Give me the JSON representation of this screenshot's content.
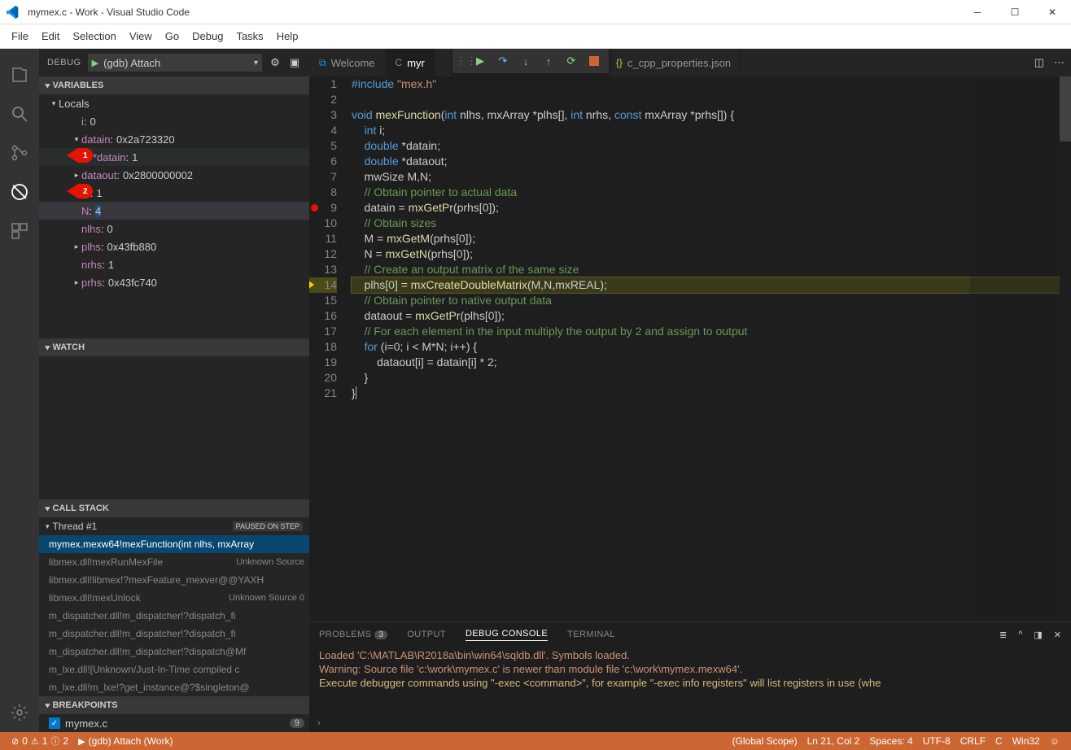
{
  "window": {
    "title": "mymex.c - Work - Visual Studio Code"
  },
  "menu": [
    "File",
    "Edit",
    "Selection",
    "View",
    "Go",
    "Debug",
    "Tasks",
    "Help"
  ],
  "debug": {
    "header_label": "DEBUG",
    "config": "(gdb) Attach"
  },
  "sections": {
    "variables": "VARIABLES",
    "watch": "WATCH",
    "callstack": "CALL STACK",
    "breakpoints": "BREAKPOINTS"
  },
  "locals_label": "Locals",
  "badges": {
    "b1": "1",
    "b2": "2"
  },
  "vars": [
    {
      "indent": 2,
      "name": "i",
      "val": "0",
      "type": "num"
    },
    {
      "indent": 2,
      "twisty": "▾",
      "name": "datain",
      "val": "0x2a723320",
      "type": "ptr"
    },
    {
      "indent": 3,
      "name": "*datain",
      "val": "1",
      "type": "num",
      "hl": true
    },
    {
      "indent": 2,
      "twisty": "▸",
      "name": "dataout",
      "val": "0x2800000002",
      "type": "ptr"
    },
    {
      "indent": 2,
      "name": "M",
      "val": "1",
      "type": "num"
    },
    {
      "indent": 2,
      "name": "N",
      "val": "4",
      "type": "num",
      "selval": true
    },
    {
      "indent": 2,
      "name": "nlhs",
      "val": "0",
      "type": "num"
    },
    {
      "indent": 2,
      "twisty": "▸",
      "name": "plhs",
      "val": "0x43fb880",
      "type": "ptr"
    },
    {
      "indent": 2,
      "name": "nrhs",
      "val": "1",
      "type": "num"
    },
    {
      "indent": 2,
      "twisty": "▸",
      "name": "prhs",
      "val": "0x43fc740",
      "type": "ptr"
    }
  ],
  "thread": {
    "label": "Thread #1",
    "status": "PAUSED ON STEP"
  },
  "callstack": [
    {
      "text": "mymex.mexw64!mexFunction(int nlhs, mxArray",
      "hl": true
    },
    {
      "text": "libmex.dll!mexRunMexFile",
      "right": "Unknown Source"
    },
    {
      "text": "libmex.dll!libmex!?mexFeature_mexver@@YAXH"
    },
    {
      "text": "libmex.dll!mexUnlock",
      "right": "Unknown Source  0"
    },
    {
      "text": "m_dispatcher.dll!m_dispatcher!?dispatch_fi"
    },
    {
      "text": "m_dispatcher.dll!m_dispatcher!?dispatch_fi"
    },
    {
      "text": "m_dispatcher.dll!m_dispatcher!?dispatch@Mf"
    },
    {
      "text": "m_lxe.dll![Unknown/Just-In-Time compiled c"
    },
    {
      "text": "m_lxe.dll!m_lxe!?get_instance@?$singleton@"
    }
  ],
  "breakpoints": [
    {
      "label": "mymex.c",
      "count": "9"
    }
  ],
  "tabs": [
    {
      "label": "Welcome",
      "icon": "vsc"
    },
    {
      "label": "myr",
      "icon": "c",
      "active": true
    },
    {
      "label": "c_cpp_properties.json",
      "icon": "json"
    }
  ],
  "code_lines": [
    {
      "n": 1,
      "html": "<span class='kw'>#include</span> <span class='str'>\"mex.h\"</span>"
    },
    {
      "n": 2,
      "html": ""
    },
    {
      "n": 3,
      "html": "<span class='kw'>void</span> <span class='fn'>mexFunction</span>(<span class='kw'>int</span> nlhs, mxArray *plhs[], <span class='kw'>int</span> nrhs, <span class='kw'>const</span> mxArray *prhs[]) {"
    },
    {
      "n": 4,
      "html": "    <span class='kw'>int</span> i;"
    },
    {
      "n": 5,
      "html": "    <span class='kw'>double</span> *datain;"
    },
    {
      "n": 6,
      "html": "    <span class='kw'>double</span> *dataout;"
    },
    {
      "n": 7,
      "html": "    mwSize M,N;"
    },
    {
      "n": 8,
      "html": "    <span class='cmt'>// Obtain pointer to actual data</span>"
    },
    {
      "n": 9,
      "html": "    datain = <span class='fn'>mxGetPr</span>(prhs[<span class='num'>0</span>]);",
      "bp": true
    },
    {
      "n": 10,
      "html": "    <span class='cmt'>// Obtain sizes</span>"
    },
    {
      "n": 11,
      "html": "    M = <span class='fn'>mxGetM</span>(prhs[<span class='num'>0</span>]);"
    },
    {
      "n": 12,
      "html": "    N = <span class='fn'>mxGetN</span>(prhs[<span class='num'>0</span>]);"
    },
    {
      "n": 13,
      "html": "    <span class='cmt'>// Create an output matrix of the same size</span>"
    },
    {
      "n": 14,
      "html": "    plhs[<span class='num'>0</span>] = <span class='fn'>mxCreateDoubleMatrix</span>(M,N,mxREAL);",
      "cur": true
    },
    {
      "n": 15,
      "html": "    <span class='cmt'>// Obtain pointer to native output data</span>"
    },
    {
      "n": 16,
      "html": "    dataout = <span class='fn'>mxGetPr</span>(plhs[<span class='num'>0</span>]);"
    },
    {
      "n": 17,
      "html": "    <span class='cmt'>// For each element in the input multiply the output by 2 and assign to output</span>"
    },
    {
      "n": 18,
      "html": "    <span class='kw'>for</span> (i=<span class='num'>0</span>; i &lt; M*N; i++) {"
    },
    {
      "n": 19,
      "html": "        dataout[i] = datain[i] * <span class='num'>2</span>;"
    },
    {
      "n": 20,
      "html": "    }"
    },
    {
      "n": 21,
      "html": "}<span class='cursor-caret'></span>"
    }
  ],
  "panel": {
    "tabs": {
      "problems": "PROBLEMS",
      "problems_badge": "3",
      "output": "OUTPUT",
      "debug": "DEBUG CONSOLE",
      "terminal": "TERMINAL"
    },
    "lines": [
      {
        "text": "Loaded 'C:\\MATLAB\\R2018a\\bin\\win64\\sqldb.dll'. Symbols loaded.",
        "cls": "orange"
      },
      {
        "text": "Warning: Source file 'c:\\work\\mymex.c' is newer than module file 'c:\\work\\mymex.mexw64'.",
        "cls": "orange"
      },
      {
        "text": "Execute debugger commands using \"-exec <command>\", for example \"-exec info registers\" will list registers in use (whe",
        "cls": "yellow"
      }
    ]
  },
  "status": {
    "errors": "0",
    "warnings": "1",
    "infos": "2",
    "debug_label": "(gdb) Attach (Work)",
    "scope": "(Global Scope)",
    "pos": "Ln 21, Col 2",
    "spaces": "Spaces: 4",
    "encoding": "UTF-8",
    "eol": "CRLF",
    "lang": "C",
    "platform": "Win32"
  }
}
